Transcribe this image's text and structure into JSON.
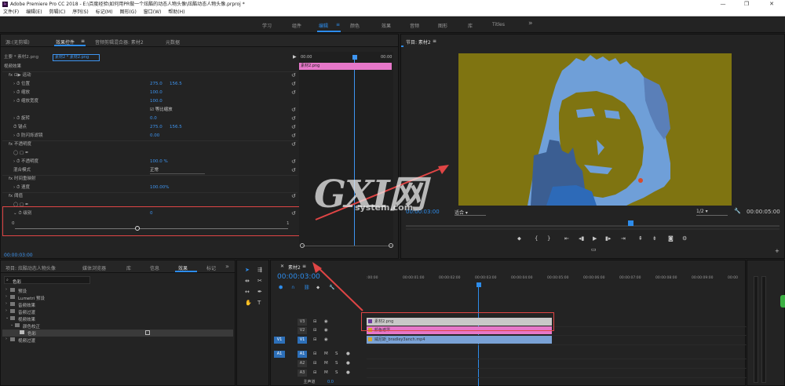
{
  "window": {
    "title": "Adobe Premiere Pro CC 2018 - E:\\百度经验\\如何用PR做一个炫酷的动态人物头像\\炫酷动态人物头像.prproj *",
    "app_icon": "Pr",
    "controls": [
      "—",
      "❐",
      "✕"
    ]
  },
  "menu": [
    "文件(F)",
    "编辑(E)",
    "剪辑(C)",
    "序列(S)",
    "标记(M)",
    "图形(G)",
    "窗口(W)",
    "帮助(H)"
  ],
  "workspaces": {
    "items": [
      "学习",
      "组件",
      "编辑",
      "颜色",
      "效果",
      "音频",
      "图形",
      "库",
      "Titles"
    ],
    "active": "编辑",
    "menu_glyph": "≡",
    "more": "»"
  },
  "source_panel": {
    "tabs": [
      "源:(无剪辑)",
      "效果控件",
      "音频剪辑混合器: 素材2",
      "元数据"
    ],
    "active_tab": "效果控件",
    "menu_glyph": "≡",
    "clip_path": "主要 * 素材2.png",
    "clip_sel": "素材2 * 素材2.png",
    "ruler": [
      "00:00",
      "00:00"
    ],
    "clip_on_track": "素材2.png",
    "rows": [
      {
        "label": "视频效果",
        "indent": 0,
        "val1": "",
        "val2": "",
        "reset": false
      },
      {
        "label": "fx  ⊡▶ 运动",
        "indent": 1,
        "val1": "",
        "val2": "",
        "reset": true
      },
      {
        "label": "› ⏱ 位置",
        "indent": 2,
        "val1": "275.0",
        "val2": "156.5",
        "reset": true
      },
      {
        "label": "› ⏱ 缩放",
        "indent": 2,
        "val1": "100.0",
        "val2": "",
        "reset": true
      },
      {
        "label": "›   ⏱ 缩放宽度",
        "indent": 2,
        "val1": "100.0",
        "val2": "",
        "reset": false
      },
      {
        "label": "",
        "indent": 2,
        "val1": "☑ 等比缩放",
        "val2": "",
        "reset": true
      },
      {
        "label": "› ⏱ 旋转",
        "indent": 2,
        "val1": "0.0",
        "val2": "",
        "reset": true
      },
      {
        "label": "  ⏱ 锚点",
        "indent": 2,
        "val1": "275.0",
        "val2": "156.5",
        "reset": true
      },
      {
        "label": "› ⏱ 防闪烁滤镜",
        "indent": 2,
        "val1": "0.00",
        "val2": "",
        "reset": true
      },
      {
        "label": "fx  不透明度",
        "indent": 1,
        "val1": "",
        "val2": "",
        "reset": true
      },
      {
        "label": "◯ ▢ ✒",
        "indent": 2,
        "val1": "",
        "val2": "",
        "reset": false
      },
      {
        "label": "› ⏱ 不透明度",
        "indent": 2,
        "val1": "100.0 %",
        "val2": "",
        "reset": true
      },
      {
        "label": "  混合模式",
        "indent": 2,
        "val1": "正常",
        "val2": "",
        "reset": true
      },
      {
        "label": "fx  时间重映射",
        "indent": 1,
        "val1": "",
        "val2": "",
        "reset": false
      },
      {
        "label": "› ⏱ 速度",
        "indent": 2,
        "val1": "100.00%",
        "val2": "",
        "reset": false
      },
      {
        "label": "fx  阈值",
        "indent": 1,
        "val1": "",
        "val2": "",
        "reset": true
      },
      {
        "label": "◯ ▢ ✒",
        "indent": 2,
        "val1": "",
        "val2": "",
        "reset": false
      },
      {
        "label": "⌄ ⏱ 级别",
        "indent": 2,
        "val1": "0",
        "val2": "",
        "reset": true
      }
    ],
    "slider_min": "0",
    "slider_max": "1",
    "timecode": "00:00:03:00"
  },
  "program_monitor": {
    "title": "节目: 素材2",
    "menu_glyph": "≡",
    "timecode": "00:00:03:00",
    "fit": "适合",
    "resolution": "1/2",
    "duration": "00:00:05:00"
  },
  "project_panel": {
    "tabs": [
      "项目: 炫酷动态人物头像",
      "媒体浏览器",
      "库",
      "信息",
      "效果",
      "标记"
    ],
    "active_tab": "效果",
    "search_value": "色彩",
    "tree": [
      {
        "label": "预设",
        "level": 0
      },
      {
        "label": "Lumetri 预设",
        "level": 0
      },
      {
        "label": "音频效果",
        "level": 0
      },
      {
        "label": "音频过渡",
        "level": 0
      },
      {
        "label": "视频效果",
        "level": 0,
        "open": true
      },
      {
        "label": "颜色校正",
        "level": 1,
        "open": true
      },
      {
        "label": "色彩",
        "level": 2,
        "selected": true
      },
      {
        "label": "视频过渡",
        "level": 0
      }
    ]
  },
  "timeline": {
    "title": "素材2",
    "menu_glyph": "≡",
    "timecode": "00:00:03:00",
    "ruler": [
      ":00:00",
      "00:00:01:00",
      "00:00:02:00",
      "00:00:03:00",
      "00:00:04:00",
      "00:00:05:00",
      "00:00:06:00",
      "00:00:07:00",
      "00:00:08:00",
      "00:00:09:00",
      "00:00"
    ],
    "tracks": [
      {
        "name": "V3",
        "kind": "video"
      },
      {
        "name": "V2",
        "kind": "video"
      },
      {
        "name": "V1",
        "kind": "video",
        "src": "V1"
      },
      {
        "name": "A1",
        "kind": "audio",
        "src": "A1"
      },
      {
        "name": "A2",
        "kind": "audio"
      },
      {
        "name": "A3",
        "kind": "audio"
      },
      {
        "name": "主声道",
        "kind": "master",
        "value": "0.0"
      }
    ],
    "clips": [
      {
        "track": "V3",
        "label": "素材2.png",
        "color": "#c8c8c8"
      },
      {
        "track": "V2",
        "label": "颜色遮罩",
        "color": "#e677c9"
      },
      {
        "track": "V1",
        "label": "威尼斯_bradley3anch.mp4",
        "color": "#7aa2d6"
      }
    ]
  },
  "watermark": {
    "brand": "GXI网",
    "site": "system.com"
  },
  "colors": {
    "accent": "#2d8ceb",
    "highlight_red": "#e04545",
    "clip_pink": "#e677c9",
    "clip_blue": "#7aa2d6",
    "mustard": "#7f7411"
  }
}
